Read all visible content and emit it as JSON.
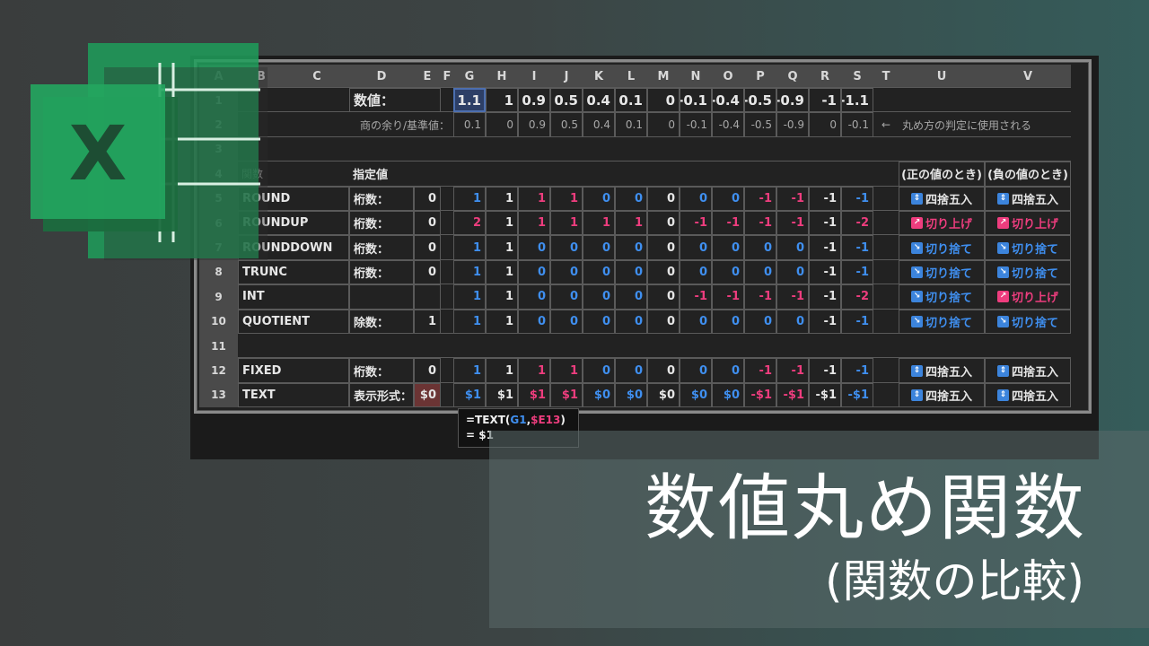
{
  "columns": [
    "A",
    "B",
    "C",
    "D",
    "E",
    "F",
    "G",
    "H",
    "I",
    "J",
    "K",
    "L",
    "M",
    "N",
    "O",
    "P",
    "Q",
    "R",
    "S",
    "T",
    "U",
    "V"
  ],
  "rows": [
    "1",
    "2",
    "3",
    "4",
    "5",
    "6",
    "7",
    "8",
    "9",
    "10",
    "11",
    "12",
    "13"
  ],
  "row1": {
    "label": "数値：",
    "values": [
      "1.1",
      "1",
      "0.9",
      "0.5",
      "0.4",
      "0.1",
      "0",
      "-0.1",
      "-0.4",
      "-0.5",
      "-0.9",
      "-1",
      "-1.1"
    ]
  },
  "row2": {
    "label": "商の余り/基準値：",
    "values": [
      "0.1",
      "0",
      "0.9",
      "0.5",
      "0.4",
      "0.1",
      "0",
      "-0.1",
      "-0.4",
      "-0.5",
      "-0.9",
      "0",
      "-0.1"
    ],
    "arrow": "←",
    "note": "丸め方の判定に使用される"
  },
  "row4": {
    "func_header": "関数",
    "spec_header": "指定値",
    "positive_header": "(正の値のとき)",
    "negative_header": "(負の値のとき)"
  },
  "functions": [
    {
      "row": "5",
      "name": "ROUND",
      "arg_label": "桁数：",
      "arg": "0",
      "values": [
        "1",
        "1",
        "1",
        "1",
        "0",
        "0",
        "0",
        "0",
        "0",
        "-1",
        "-1",
        "-1",
        "-1"
      ],
      "colors": [
        "b",
        "w",
        "p",
        "p",
        "b",
        "b",
        "w",
        "b",
        "b",
        "p",
        "p",
        "w",
        "b"
      ],
      "pos": {
        "icon": "⇕",
        "text": "四捨五入",
        "color": "w"
      },
      "neg": {
        "icon": "⇕",
        "text": "四捨五入",
        "color": "w"
      }
    },
    {
      "row": "6",
      "name": "ROUNDUP",
      "arg_label": "桁数：",
      "arg": "0",
      "values": [
        "2",
        "1",
        "1",
        "1",
        "1",
        "1",
        "0",
        "-1",
        "-1",
        "-1",
        "-1",
        "-1",
        "-2"
      ],
      "colors": [
        "p",
        "w",
        "p",
        "p",
        "p",
        "p",
        "w",
        "p",
        "p",
        "p",
        "p",
        "w",
        "p"
      ],
      "pos": {
        "icon": "↗",
        "text": "切り上げ",
        "color": "p"
      },
      "neg": {
        "icon": "↗",
        "text": "切り上げ",
        "color": "p"
      }
    },
    {
      "row": "7",
      "name": "ROUNDDOWN",
      "arg_label": "桁数：",
      "arg": "0",
      "values": [
        "1",
        "1",
        "0",
        "0",
        "0",
        "0",
        "0",
        "0",
        "0",
        "0",
        "0",
        "-1",
        "-1"
      ],
      "colors": [
        "b",
        "w",
        "b",
        "b",
        "b",
        "b",
        "w",
        "b",
        "b",
        "b",
        "b",
        "w",
        "b"
      ],
      "pos": {
        "icon": "↘",
        "text": "切り捨て",
        "color": "b"
      },
      "neg": {
        "icon": "↘",
        "text": "切り捨て",
        "color": "b"
      }
    },
    {
      "row": "8",
      "name": "TRUNC",
      "arg_label": "桁数：",
      "arg": "0",
      "values": [
        "1",
        "1",
        "0",
        "0",
        "0",
        "0",
        "0",
        "0",
        "0",
        "0",
        "0",
        "-1",
        "-1"
      ],
      "colors": [
        "b",
        "w",
        "b",
        "b",
        "b",
        "b",
        "w",
        "b",
        "b",
        "b",
        "b",
        "w",
        "b"
      ],
      "pos": {
        "icon": "↘",
        "text": "切り捨て",
        "color": "b"
      },
      "neg": {
        "icon": "↘",
        "text": "切り捨て",
        "color": "b"
      }
    },
    {
      "row": "9",
      "name": "INT",
      "arg_label": "",
      "arg": "",
      "values": [
        "1",
        "1",
        "0",
        "0",
        "0",
        "0",
        "0",
        "-1",
        "-1",
        "-1",
        "-1",
        "-1",
        "-2"
      ],
      "colors": [
        "b",
        "w",
        "b",
        "b",
        "b",
        "b",
        "w",
        "p",
        "p",
        "p",
        "p",
        "w",
        "p"
      ],
      "pos": {
        "icon": "↘",
        "text": "切り捨て",
        "color": "b"
      },
      "neg": {
        "icon": "↗",
        "text": "切り上げ",
        "color": "p"
      }
    },
    {
      "row": "10",
      "name": "QUOTIENT",
      "arg_label": "除数：",
      "arg": "1",
      "values": [
        "1",
        "1",
        "0",
        "0",
        "0",
        "0",
        "0",
        "0",
        "0",
        "0",
        "0",
        "-1",
        "-1"
      ],
      "colors": [
        "b",
        "w",
        "b",
        "b",
        "b",
        "b",
        "w",
        "b",
        "b",
        "b",
        "b",
        "w",
        "b"
      ],
      "pos": {
        "icon": "↘",
        "text": "切り捨て",
        "color": "b"
      },
      "neg": {
        "icon": "↘",
        "text": "切り捨て",
        "color": "b"
      }
    },
    {
      "row": "12",
      "name": "FIXED",
      "arg_label": "桁数：",
      "arg": "0",
      "values": [
        "1",
        "1",
        "1",
        "1",
        "0",
        "0",
        "0",
        "0",
        "0",
        "-1",
        "-1",
        "-1",
        "-1"
      ],
      "colors": [
        "b",
        "w",
        "p",
        "p",
        "b",
        "b",
        "w",
        "b",
        "b",
        "p",
        "p",
        "w",
        "b"
      ],
      "pos": {
        "icon": "⇕",
        "text": "四捨五入",
        "color": "w"
      },
      "neg": {
        "icon": "⇕",
        "text": "四捨五入",
        "color": "w"
      }
    },
    {
      "row": "13",
      "name": "TEXT",
      "arg_label": "表示形式：",
      "arg": "$0",
      "values": [
        "$1",
        "$1",
        "$1",
        "$1",
        "$0",
        "$0",
        "$0",
        "$0",
        "$0",
        "-$1",
        "-$1",
        "-$1",
        "-$1"
      ],
      "colors": [
        "b",
        "w",
        "p",
        "p",
        "b",
        "b",
        "w",
        "b",
        "b",
        "p",
        "p",
        "w",
        "b"
      ],
      "pos": {
        "icon": "⇕",
        "text": "四捨五入",
        "color": "w"
      },
      "neg": {
        "icon": "⇕",
        "text": "四捨五入",
        "color": "w"
      }
    }
  ],
  "tooltip": {
    "formula_prefix": "=TEXT(",
    "ref1": "G1",
    "comma": ",",
    "ref2": "$E13",
    "formula_suffix": ")",
    "result": "= $1"
  },
  "title": {
    "main": "数値丸め関数",
    "sub": "(関数の比較)"
  },
  "colors": {
    "blue": "#3f8ff0",
    "pink": "#ee3d7e",
    "excel_green": "#1f9d5a",
    "excel_dark": "#1b6b3e"
  },
  "icons": [
    "excel-logo-icon",
    "round-half-icon",
    "round-up-icon",
    "round-down-icon",
    "left-arrow-icon"
  ]
}
